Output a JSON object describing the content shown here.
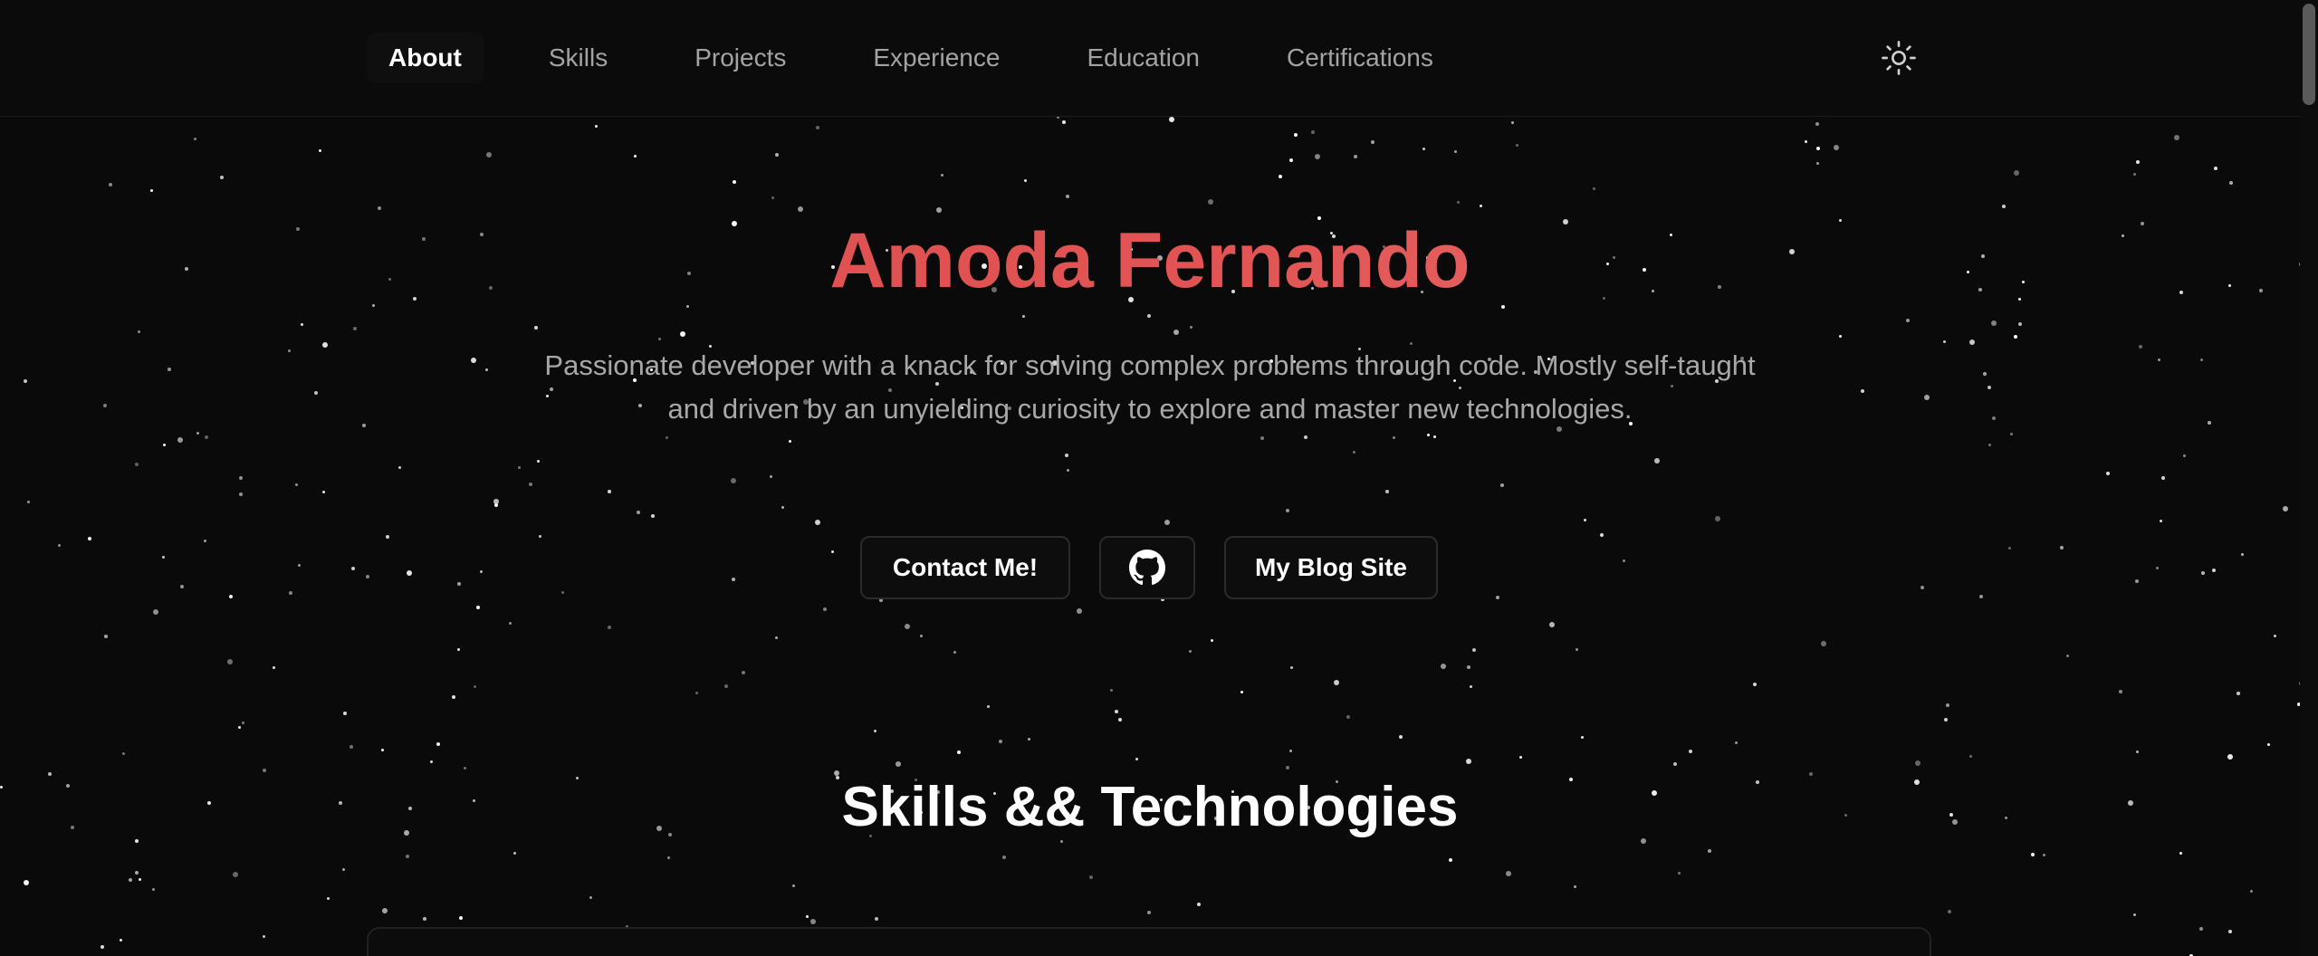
{
  "nav": {
    "items": [
      {
        "label": "About",
        "active": true
      },
      {
        "label": "Skills",
        "active": false
      },
      {
        "label": "Projects",
        "active": false
      },
      {
        "label": "Experience",
        "active": false
      },
      {
        "label": "Education",
        "active": false
      },
      {
        "label": "Certifications",
        "active": false
      }
    ],
    "theme_toggle_icon": "sun-icon"
  },
  "hero": {
    "name": "Amoda Fernando",
    "bio": "Passionate developer with a knack for solving complex problems through code. Mostly self-taught and driven by an unyielding curiosity to explore and master new technologies.",
    "buttons": {
      "contact_label": "Contact Me!",
      "github_icon": "github-icon",
      "blog_label": "My Blog Site"
    }
  },
  "skills_section": {
    "title": "Skills && Technologies"
  },
  "colors": {
    "background": "#0a0a0a",
    "accent_gradient_start": "#dc4a4a",
    "accent_gradient_end": "#ec7a78",
    "text_muted": "#a8a8a8",
    "nav_inactive": "#a3a3a3"
  }
}
